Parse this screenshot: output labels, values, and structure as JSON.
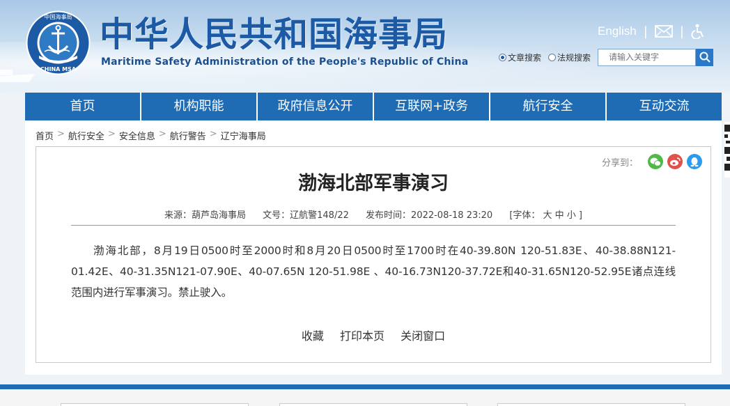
{
  "header": {
    "logo_text_ring": "中国海事局",
    "logo_text_bottom": "CHINA MSA",
    "title": "中华人民共和国海事局",
    "subtitle": "Maritime Safety Administration of the People's Republic of China",
    "english_link": "English",
    "icons": [
      "mail-icon",
      "accessibility-icon"
    ],
    "search": {
      "radio_article": "文章搜索",
      "radio_regulation": "法规搜索",
      "selected": "文章搜索",
      "placeholder": "请输入关键字"
    }
  },
  "nav": {
    "items": [
      "首页",
      "机构职能",
      "政府信息公开",
      "互联网+政务",
      "航行安全",
      "互动交流"
    ]
  },
  "breadcrumb": [
    "首页",
    "航行安全",
    "安全信息",
    "航行警告",
    "辽宁海事局"
  ],
  "article": {
    "share_label": "分享到：",
    "share_icons": [
      "wechat-icon",
      "weibo-icon",
      "qq-icon"
    ],
    "title": "渤海北部军事演习",
    "source": "来源：葫芦岛海事局",
    "doc_no": "文号：辽航警148/22",
    "publish_time": "发布时间：2022-08-18 23:20",
    "font_size_ctrl": "[字体： 大  中  小 ]",
    "body": "渤海北部，8月19日0500时至2000时和8月20日0500时至1700时在40-39.80N 120-51.83E、40-38.88N121-01.42E、40-31.35N121-07.90E、40-07.65N 120-51.98E 、40-16.73N120-37.72E和40-31.65N120-52.95E诸点连线范围内进行军事演习。禁止驶入。",
    "actions": {
      "favorite": "收藏",
      "print": "打印本页",
      "close": "关闭窗口"
    }
  },
  "colors": {
    "nav_bg": "#1f6cb4",
    "title_blue": "#1c5aa6",
    "wechat": "#52b849",
    "weibo": "#e0534a",
    "qq": "#2a9bef"
  }
}
